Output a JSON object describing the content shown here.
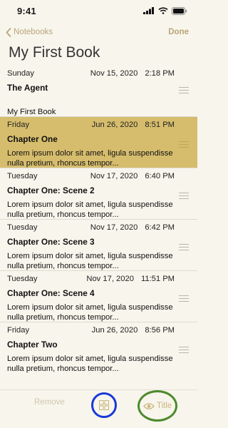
{
  "status": {
    "time": "9:41"
  },
  "nav": {
    "back_label": "Notebooks",
    "done_label": "Done"
  },
  "page": {
    "title": "My First Book"
  },
  "rows": [
    {
      "day": "Sunday",
      "date": "Nov 15, 2020",
      "time": "2:18 PM",
      "title": "The Agent",
      "snippet": "My First Book",
      "selected": false
    },
    {
      "day": "Friday",
      "date": "Jun 26, 2020",
      "time": "8:51 PM",
      "title": "Chapter One",
      "snippet": "Lorem ipsum dolor sit amet, ligula suspendisse nulla pretium, rhoncus tempor...",
      "selected": true
    },
    {
      "day": "Tuesday",
      "date": "Nov 17, 2020",
      "time": "6:40 PM",
      "title": "Chapter One: Scene 2",
      "snippet": "Lorem ipsum dolor sit amet, ligula suspendisse nulla pretium, rhoncus tempor...",
      "selected": false
    },
    {
      "day": "Tuesday",
      "date": "Nov 17, 2020",
      "time": "6:42 PM",
      "title": "Chapter One: Scene 3",
      "snippet": "Lorem ipsum dolor sit amet, ligula suspendisse nulla pretium, rhoncus tempor...",
      "selected": false
    },
    {
      "day": "Tuesday",
      "date": "Nov 17, 2020",
      "time": "11:51 PM",
      "title": "Chapter One: Scene 4",
      "snippet": "Lorem ipsum dolor sit amet, ligula suspendisse nulla pretium, rhoncus tempor...",
      "selected": false
    },
    {
      "day": "Friday",
      "date": "Jun 26, 2020",
      "time": "8:56 PM",
      "title": "Chapter Two",
      "snippet": "Lorem ipsum dolor sit amet, ligula suspendisse nulla pretium, rhoncus tempor...",
      "selected": false
    }
  ],
  "toolbar": {
    "remove_label": "Remove",
    "title_label": "Title"
  },
  "colors": {
    "accent": "#b8a67a",
    "selected_row": "#d6bd6d",
    "grid_highlight": "#1a3ad6",
    "title_highlight": "#4c8a2c"
  },
  "icons": [
    "chevron-left-icon",
    "cellular-icon",
    "wifi-icon",
    "battery-icon",
    "drag-handle-icon",
    "grid-icon",
    "eye-icon"
  ]
}
